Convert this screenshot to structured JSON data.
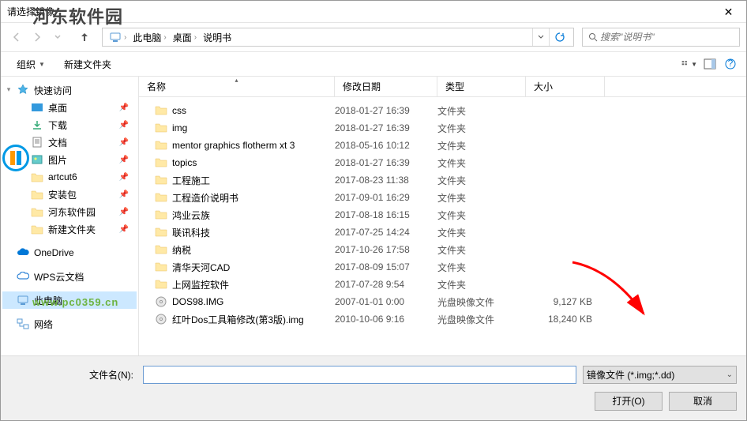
{
  "title": "请选择镜像",
  "watermark": {
    "text": "河东软件园",
    "url": "www.pc0359.cn"
  },
  "breadcrumb": {
    "root_icon": "pc",
    "parts": [
      "此电脑",
      "桌面",
      "说明书"
    ]
  },
  "search": {
    "placeholder": "搜索\"说明书\""
  },
  "toolbar": {
    "organize": "组织",
    "newfolder": "新建文件夹"
  },
  "columns": {
    "name": "名称",
    "date": "修改日期",
    "type": "类型",
    "size": "大小"
  },
  "sidebar": {
    "quick": "快速访问",
    "items": [
      {
        "label": "桌面",
        "icon": "desktop",
        "pin": true
      },
      {
        "label": "下载",
        "icon": "download",
        "pin": true
      },
      {
        "label": "文档",
        "icon": "doc",
        "pin": true
      },
      {
        "label": "图片",
        "icon": "pic",
        "pin": true
      },
      {
        "label": "artcut6",
        "icon": "folder",
        "pin": true
      },
      {
        "label": "安装包",
        "icon": "folder",
        "pin": true
      },
      {
        "label": "河东软件园",
        "icon": "folder",
        "pin": true
      },
      {
        "label": "新建文件夹",
        "icon": "folder",
        "pin": true
      }
    ],
    "onedrive": "OneDrive",
    "wps": "WPS云文档",
    "thispc": "此电脑",
    "network": "网络"
  },
  "files": [
    {
      "name": "css",
      "date": "2018-01-27 16:39",
      "type": "文件夹",
      "size": "",
      "icon": "folder"
    },
    {
      "name": "img",
      "date": "2018-01-27 16:39",
      "type": "文件夹",
      "size": "",
      "icon": "folder"
    },
    {
      "name": "mentor graphics flotherm xt 3",
      "date": "2018-05-16 10:12",
      "type": "文件夹",
      "size": "",
      "icon": "folder"
    },
    {
      "name": "topics",
      "date": "2018-01-27 16:39",
      "type": "文件夹",
      "size": "",
      "icon": "folder"
    },
    {
      "name": "工程施工",
      "date": "2017-08-23 11:38",
      "type": "文件夹",
      "size": "",
      "icon": "folder"
    },
    {
      "name": "工程造价说明书",
      "date": "2017-09-01 16:29",
      "type": "文件夹",
      "size": "",
      "icon": "folder"
    },
    {
      "name": "鸿业云族",
      "date": "2017-08-18 16:15",
      "type": "文件夹",
      "size": "",
      "icon": "folder"
    },
    {
      "name": "联讯科技",
      "date": "2017-07-25 14:24",
      "type": "文件夹",
      "size": "",
      "icon": "folder"
    },
    {
      "name": "纳税",
      "date": "2017-10-26 17:58",
      "type": "文件夹",
      "size": "",
      "icon": "folder"
    },
    {
      "name": "清华天河CAD",
      "date": "2017-08-09 15:07",
      "type": "文件夹",
      "size": "",
      "icon": "folder"
    },
    {
      "name": "上网监控软件",
      "date": "2017-07-28 9:54",
      "type": "文件夹",
      "size": "",
      "icon": "folder"
    },
    {
      "name": "DOS98.IMG",
      "date": "2007-01-01 0:00",
      "type": "光盘映像文件",
      "size": "9,127 KB",
      "icon": "disc"
    },
    {
      "name": "红叶Dos工具箱修改(第3版).img",
      "date": "2010-10-06 9:16",
      "type": "光盘映像文件",
      "size": "18,240 KB",
      "icon": "disc"
    }
  ],
  "bottom": {
    "filename_label": "文件名(N):",
    "filename_value": "",
    "filter": "镜像文件 (*.img;*.dd)",
    "open": "打开(O)",
    "cancel": "取消"
  }
}
